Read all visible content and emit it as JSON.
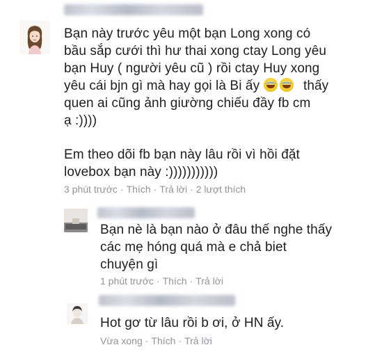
{
  "comments": [
    {
      "author_blurred": true,
      "avatar_icon": "girl-avatar-icon",
      "lines": [
        "Bạn này trước yêu một bạn Long xong có",
        "bầu sắp cưới thì hư thai xong ctay Long yêu",
        "bạn Huy ( người yêu cũ ) rồi ctay Huy xong",
        "yêu cái bjn gì mà hay gọi là Bi ấy",
        "thấy",
        "quen ai cũng ảnh giường chiếu đầy fb cm",
        "ạ :))))"
      ],
      "lines2": [
        "Em theo dõi fb bạn này lâu rồi vì hồi đặt",
        "lovebox bạn này :)))))))))))"
      ],
      "emoji": "tears-of-joy-emoji",
      "meta": {
        "time": "3 phút trước",
        "like": "Thích",
        "reply": "Trả lời",
        "likes_count": "2 lượt thích"
      }
    },
    {
      "author_blurred": true,
      "avatar_icon": "user-avatar-icon",
      "lines": [
        "Bạn nè là bạn nào ở đâu thế nghe thấy",
        "các mẹ hóng quá mà e chả biet",
        "chuyện gì"
      ],
      "meta": {
        "time": "1 phút trước",
        "like": "Thích",
        "reply": "Trả lời"
      }
    },
    {
      "author_blurred": true,
      "avatar_icon": "user-avatar-icon",
      "lines": [
        "Hot gơ từ lâu rồi b ơi, ở HN ấy."
      ],
      "meta": {
        "time": "Vừa xong",
        "like": "Thích",
        "reply": "Trả lời"
      }
    }
  ],
  "separator": "·"
}
